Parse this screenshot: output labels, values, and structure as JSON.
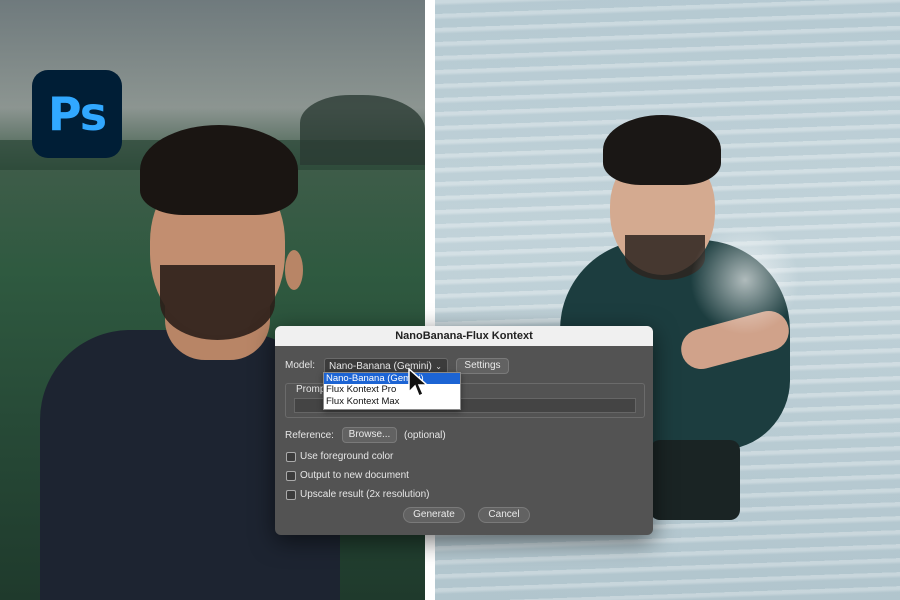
{
  "logo": {
    "text": "Ps"
  },
  "dialog": {
    "title": "NanoBanana-Flux Kontext",
    "model_label": "Model:",
    "model_selected": "Nano-Banana (Gemini)",
    "settings_label": "Settings",
    "prompt_label": "Prompt",
    "reference_label": "Reference:",
    "browse_label": "Browse...",
    "optional_label": "(optional)",
    "checkboxes": [
      {
        "label": "Use foreground color"
      },
      {
        "label": "Output to new document"
      },
      {
        "label": "Upscale result (2x resolution)"
      }
    ],
    "generate_label": "Generate",
    "cancel_label": "Cancel"
  },
  "dropdown": {
    "options": [
      "Nano-Banana (Gemini)",
      "Flux Kontext Pro",
      "Flux Kontext Max"
    ],
    "highlighted": "Nano-Banana (Gemini)"
  },
  "colors": {
    "ps_bg": "#001e36",
    "ps_text": "#31a8ff",
    "dialog_bg": "#535353",
    "highlight": "#1c64d4"
  }
}
